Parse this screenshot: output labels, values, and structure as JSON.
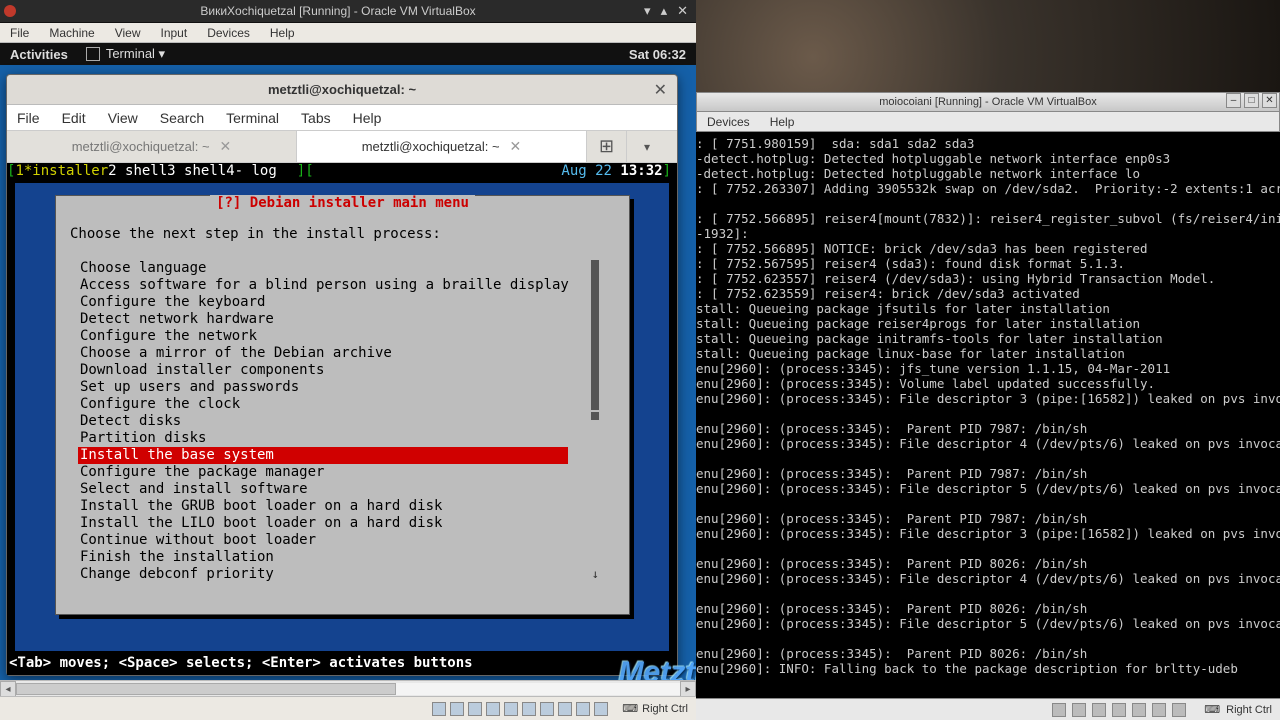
{
  "host_titlebar": {
    "title": "ВикиXochiquetzal [Running] - Oracle VM VirtualBox"
  },
  "vm1_menubar": [
    "File",
    "Machine",
    "View",
    "Input",
    "Devices",
    "Help"
  ],
  "gnome": {
    "activities": "Activities",
    "app": "Terminal ▾",
    "clock": "Sat 06:32"
  },
  "term_window": {
    "title": "metztli@xochiquetzal: ~",
    "menubar": [
      "File",
      "Edit",
      "View",
      "Search",
      "Terminal",
      "Tabs",
      "Help"
    ],
    "tabs": [
      {
        "label": "metztli@xochiquetzal: ~",
        "active": false
      },
      {
        "label": "metztli@xochiquetzal: ~",
        "active": true
      }
    ]
  },
  "screen_line": {
    "left_bracket": "[",
    "sessions": [
      {
        "num": "1",
        "sep": "*",
        "name": "installer",
        "sel": true
      },
      {
        "num": "2",
        "sep": " ",
        "name": "shell"
      },
      {
        "num": "3",
        "sep": " ",
        "name": "shell"
      },
      {
        "num": "4",
        "sep": "- ",
        "name": "log"
      }
    ],
    "right_bracket": "][",
    "date": "Aug 22",
    "time": "13:32",
    "end": "]"
  },
  "installer": {
    "title": "[?] Debian installer main menu",
    "prompt": "Choose the next step in the install process:",
    "items": [
      "Choose language",
      "Access software for a blind person using a braille display",
      "Configure the keyboard",
      "Detect network hardware",
      "Configure the network",
      "Choose a mirror of the Debian archive",
      "Download installer components",
      "Set up users and passwords",
      "Configure the clock",
      "Detect disks",
      "Partition disks",
      "Install the base system",
      "Configure the package manager",
      "Select and install software",
      "Install the GRUB boot loader on a hard disk",
      "Install the LILO boot loader on a hard disk",
      "Continue without boot loader",
      "Finish the installation",
      "Change debconf priority"
    ],
    "selected_index": 11
  },
  "hint": "<Tab> moves; <Space> selects; <Enter> activates buttons",
  "watermark": "Metztli IT",
  "vm1_status_host_key": "Right Ctrl",
  "vm2": {
    "title": "moiocoiani [Running] - Oracle VM VirtualBox",
    "menubar": [
      "Devices",
      "Help"
    ],
    "status_host_key": "Right Ctrl",
    "console_lines": [
      ": [ 7751.980159]  sda: sda1 sda2 sda3",
      "-detect.hotplug: Detected hotpluggable network interface enp0s3",
      "-detect.hotplug: Detected hotpluggable network interface lo",
      ": [ 7752.263307] Adding 3905532k swap on /dev/sda2.  Priority:-2 extents:1 acr",
      "",
      ": [ 7752.566895] reiser4[mount(7832)]: reiser4_register_subvol (fs/reiser4/ini",
      "-1932]:",
      ": [ 7752.566895] NOTICE: brick /dev/sda3 has been registered",
      ": [ 7752.567595] reiser4 (sda3): found disk format 5.1.3.",
      ": [ 7752.623557] reiser4 (/dev/sda3): using Hybrid Transaction Model.",
      ": [ 7752.623559] reiser4: brick /dev/sda3 activated",
      "stall: Queueing package jfsutils for later installation",
      "stall: Queueing package reiser4progs for later installation",
      "stall: Queueing package initramfs-tools for later installation",
      "stall: Queueing package linux-base for later installation",
      "enu[2960]: (process:3345): jfs_tune version 1.1.15, 04-Mar-2011",
      "enu[2960]: (process:3345): Volume label updated successfully.",
      "enu[2960]: (process:3345): File descriptor 3 (pipe:[16582]) leaked on pvs invo",
      "",
      "enu[2960]: (process:3345):  Parent PID 7987: /bin/sh",
      "enu[2960]: (process:3345): File descriptor 4 (/dev/pts/6) leaked on pvs invoca",
      "",
      "enu[2960]: (process:3345):  Parent PID 7987: /bin/sh",
      "enu[2960]: (process:3345): File descriptor 5 (/dev/pts/6) leaked on pvs invoca",
      "",
      "enu[2960]: (process:3345):  Parent PID 7987: /bin/sh",
      "enu[2960]: (process:3345): File descriptor 3 (pipe:[16582]) leaked on pvs invo",
      "",
      "enu[2960]: (process:3345):  Parent PID 8026: /bin/sh",
      "enu[2960]: (process:3345): File descriptor 4 (/dev/pts/6) leaked on pvs invoca",
      "",
      "enu[2960]: (process:3345):  Parent PID 8026: /bin/sh",
      "enu[2960]: (process:3345): File descriptor 5 (/dev/pts/6) leaked on pvs invoca",
      "",
      "enu[2960]: (process:3345):  Parent PID 8026: /bin/sh",
      "enu[2960]: INFO: Falling back to the package description for brltty-udeb"
    ]
  }
}
